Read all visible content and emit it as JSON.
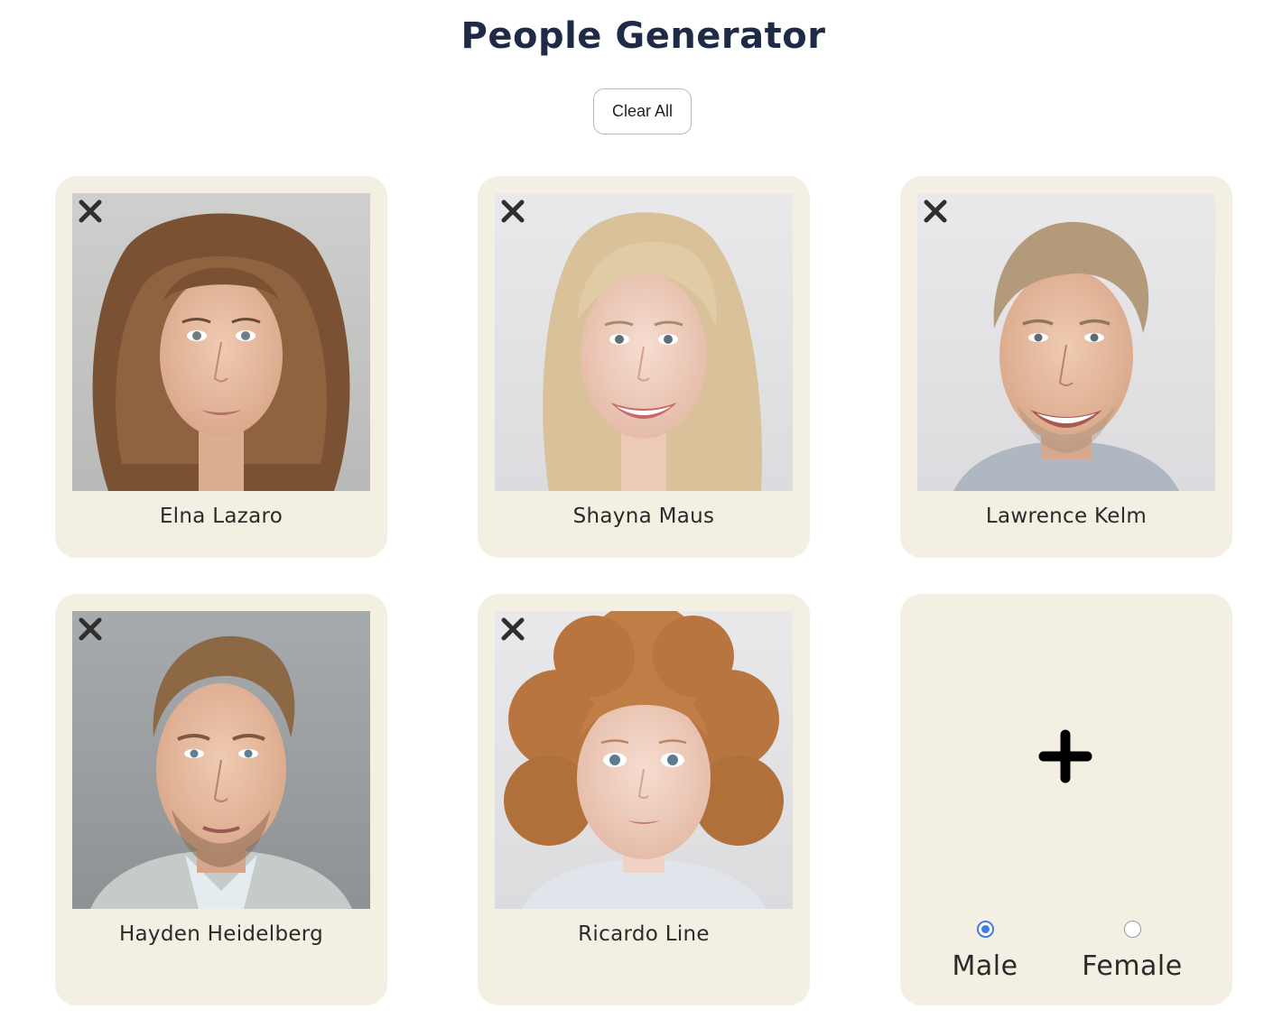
{
  "page": {
    "title": "People Generator"
  },
  "toolbar": {
    "clear_all_label": "Clear All"
  },
  "people": [
    {
      "name": "Elna Lazaro",
      "photo": "portrait-woman-curly-brown-hair"
    },
    {
      "name": "Shayna Maus",
      "photo": "portrait-woman-blonde-smiling"
    },
    {
      "name": "Lawrence Kelm",
      "photo": "portrait-man-blond-smiling"
    },
    {
      "name": "Hayden Heidelberg",
      "photo": "portrait-man-short-hair-beard"
    },
    {
      "name": "Ricardo Line",
      "photo": "portrait-child-curly-red-hair"
    }
  ],
  "add_card": {
    "plus_icon": "plus-icon",
    "gender_options": [
      {
        "label": "Male",
        "checked": true
      },
      {
        "label": "Female",
        "checked": false
      }
    ]
  },
  "colors": {
    "card_background": "#f4efe3",
    "title_color": "#1f2b46",
    "radio_accent": "#3b7ce6"
  }
}
